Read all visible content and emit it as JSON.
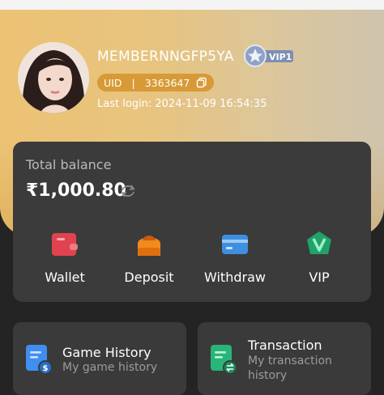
{
  "profile": {
    "username": "MEMBERNNGFP5YA",
    "vip_badge": "VIP1",
    "uid_label": "UID",
    "uid_separator": "|",
    "uid_value": "3363647",
    "last_login": "Last login: 2024-11-09 16:54:35"
  },
  "balance": {
    "label": "Total balance",
    "value": "₹1,000.80"
  },
  "actions": [
    {
      "label": "Wallet",
      "icon": "wallet-icon",
      "color": "#e0434f"
    },
    {
      "label": "Deposit",
      "icon": "deposit-icon",
      "color": "#f28a1e"
    },
    {
      "label": "Withdraw",
      "icon": "withdraw-icon",
      "color": "#3d8fe0"
    },
    {
      "label": "VIP",
      "icon": "vip-icon",
      "color": "#1fa36a"
    }
  ],
  "tiles": [
    {
      "title": "Game History",
      "subtitle": "My game history",
      "icon": "game-history-icon",
      "color": "#3f8ef0"
    },
    {
      "title": "Transaction",
      "subtitle_line1": "My transaction",
      "subtitle_line2": "history",
      "icon": "transaction-icon",
      "color": "#27b57a"
    }
  ],
  "colors": {
    "header_gold": "#e7c47f",
    "uid_pill": "#d79a36",
    "card_bg": "#3b3b3b",
    "page_bg": "#242424"
  }
}
